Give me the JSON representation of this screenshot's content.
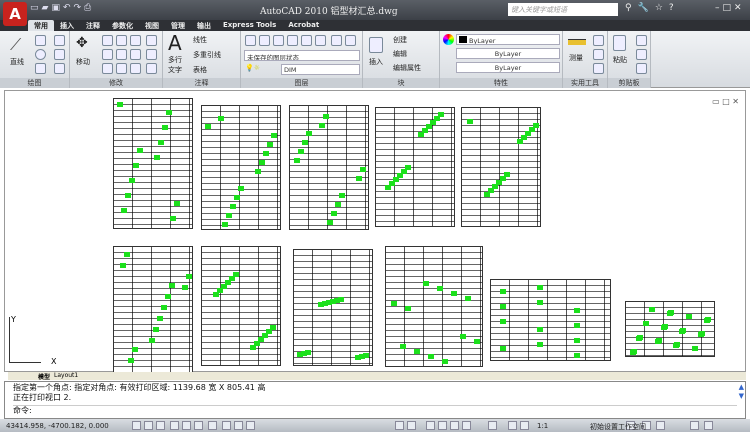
{
  "titlebar": {
    "title": "AutoCAD 2010  铝型材汇总.dwg",
    "search_placeholder": "键入关键字或短语",
    "app_button": "A"
  },
  "tabs": [
    "常用",
    "插入",
    "注释",
    "参数化",
    "视图",
    "管理",
    "输出",
    "Express Tools",
    "Acrobat"
  ],
  "ribbon": {
    "draw": {
      "label": "绘图",
      "line": "直线"
    },
    "modify": {
      "label": "修改",
      "move": "移动"
    },
    "annotation": {
      "label": "注释",
      "mtext": "多行文字",
      "linear": "线性",
      "mleader": "多重引线",
      "table": "表格"
    },
    "layers": {
      "label": "图层",
      "state": "未保存的图层状态",
      "layer": "DIM"
    },
    "block": {
      "label": "块",
      "insert": "插入",
      "create": "创建",
      "edit": "编辑",
      "edit_attr": "编辑属性"
    },
    "properties": {
      "label": "特性",
      "color": "ByLayer",
      "linetype": "ByLayer",
      "lineweight": "ByLayer"
    },
    "utilities": {
      "label": "实用工具",
      "measure": "测量"
    },
    "clipboard": {
      "label": "剪贴板",
      "paste": "粘贴"
    }
  },
  "layout_tabs": [
    "模型",
    "Layout1"
  ],
  "axes": {
    "x": "X",
    "y": "Y"
  },
  "command": {
    "line1": "指定第一个角点: 指定对角点: 有效打印区域:  1139.68 宽 X 805.41 高",
    "line2": "正在打印视口 2.",
    "prompt": "命令:"
  },
  "status": {
    "coords": "43414.958, -4700.182, 0.000",
    "scale": "1:1",
    "workspace": "初始设置工作空间"
  }
}
